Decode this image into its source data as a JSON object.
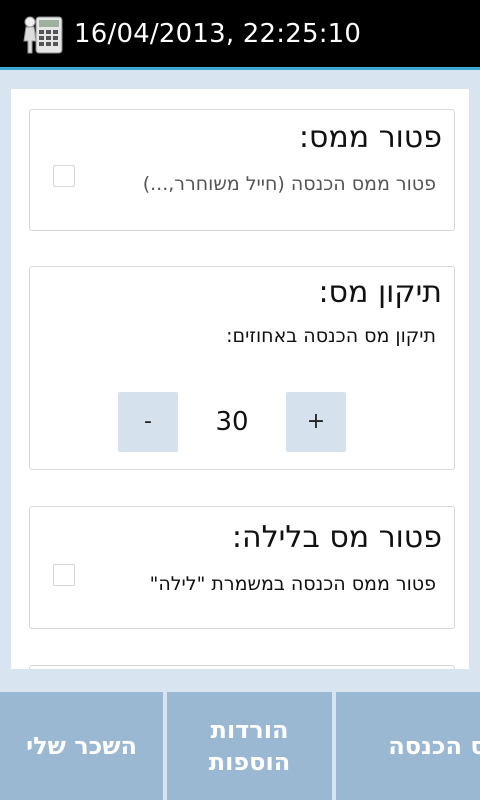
{
  "title_bar": {
    "datetime": "16/04/2013, 22:25:10",
    "icon": "calculator-worker-icon"
  },
  "cards": {
    "exemption": {
      "title": "פטור ממס:",
      "subtitle": "פטור ממס הכנסה (חייל משוחרר,...)",
      "checked": false
    },
    "tax_adjustment": {
      "title": "תיקון מס:",
      "subtitle": "תיקון מס הכנסה באחוזים:",
      "stepper": {
        "minus_label": "-",
        "value": "30",
        "plus_label": "+"
      }
    },
    "night_exemption": {
      "title": "פטור מס בלילה:",
      "subtitle": "פטור ממס הכנסה במשמרת \"לילה\"",
      "checked": false
    }
  },
  "bottom_tabs": {
    "my_salary": "השכר שלי",
    "deductions_line1": "הורדות",
    "deductions_line2": "הוספות",
    "income_tax": "מס הכנסה"
  },
  "colors": {
    "accent_line": "#3fa7d6",
    "tab_background": "#9bb8d3",
    "stepper_button": "#d5e2ee",
    "screen_background": "#d8e4ef"
  }
}
